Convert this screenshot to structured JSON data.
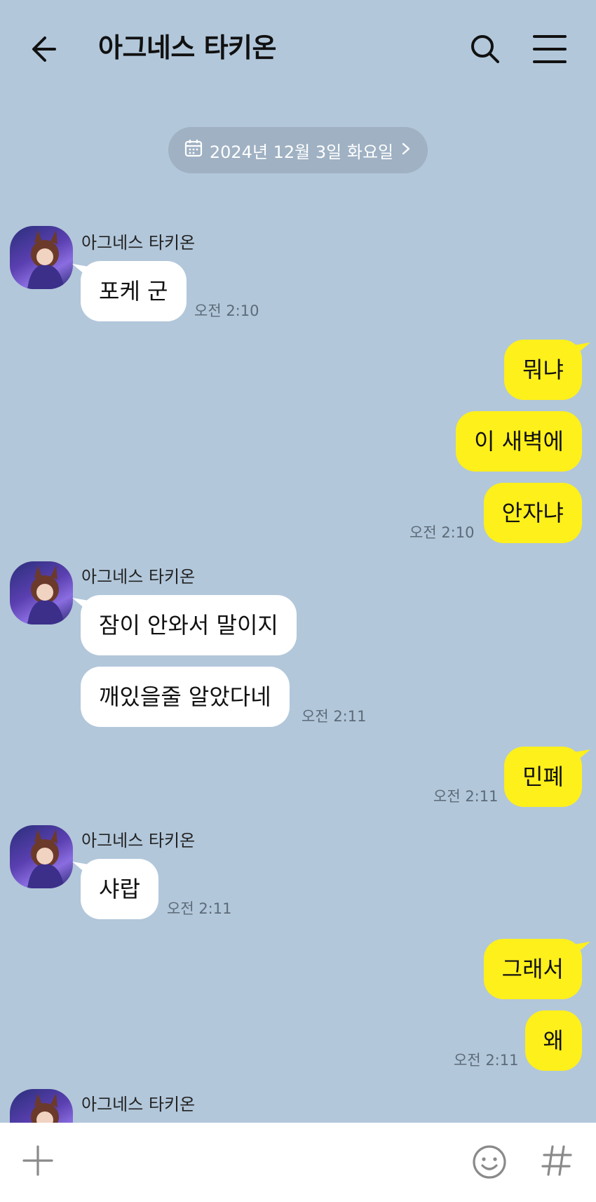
{
  "header": {
    "title": "아그네스 타키온",
    "icons": [
      "back-arrow-icon",
      "search-icon",
      "menu-icon"
    ]
  },
  "date_divider": {
    "label": "2024년 12월 3일 화요일",
    "icon": "calendar-icon"
  },
  "contact": {
    "name": "아그네스 타키온"
  },
  "messages": [
    {
      "from": "contact",
      "text": "포케 군",
      "time": "오전 2:10"
    },
    {
      "from": "me",
      "text": "뭐냐"
    },
    {
      "from": "me",
      "text": "이 새벽에"
    },
    {
      "from": "me",
      "text": "안자냐",
      "time": "오전 2:10"
    },
    {
      "from": "contact",
      "text": "잠이 안와서 말이지"
    },
    {
      "from": "contact",
      "text": "깨있을줄 알았다네",
      "time": "오전 2:11"
    },
    {
      "from": "me",
      "text": "민폐",
      "time": "오전 2:11"
    },
    {
      "from": "contact",
      "text": "샤랍",
      "time": "오전 2:11"
    },
    {
      "from": "me",
      "text": "그래서"
    },
    {
      "from": "me",
      "text": "왜",
      "time": "오전 2:11"
    }
  ],
  "input_bar": {
    "icons": [
      "plus-icon",
      "emoji-icon",
      "hashtag-icon"
    ]
  },
  "colors": {
    "background": "#b2c7da",
    "my_bubble": "#fef01b",
    "their_bubble": "#ffffff"
  }
}
